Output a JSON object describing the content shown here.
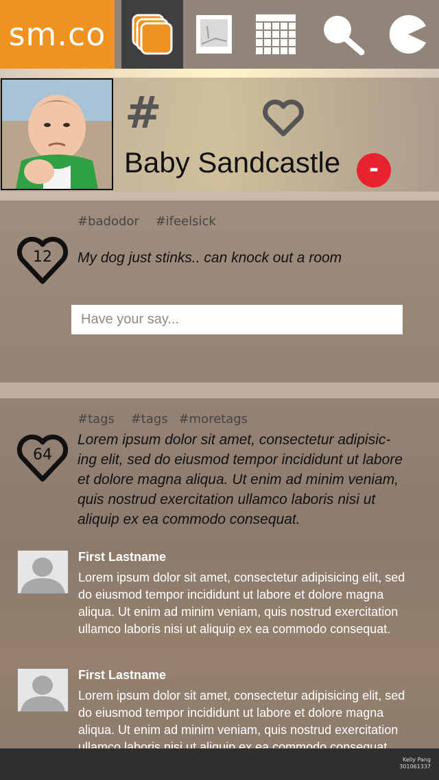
{
  "header": {
    "logo": "sm.co",
    "nav": [
      {
        "icon": "stack-cards-icon",
        "active": true
      },
      {
        "icon": "image-icon",
        "active": false
      },
      {
        "icon": "calendar-icon",
        "active": false
      },
      {
        "icon": "search-icon",
        "active": false
      },
      {
        "icon": "pacman-icon",
        "active": false
      }
    ],
    "colors": {
      "logo_bg": "#f0921f",
      "active_nav": "#3f3f3f",
      "remove": "#e8232f"
    }
  },
  "profile": {
    "name": "Baby Sandcastle",
    "hash_symbol": "#",
    "remove_label": "-"
  },
  "posts": [
    {
      "tags": [
        "#badodor",
        "#ifeelsick"
      ],
      "likes": "12",
      "text": "My dog just stinks.. can knock out a room",
      "comment_placeholder": "Have your say..."
    },
    {
      "tags": [
        "#tags",
        "#tags",
        "#moretags"
      ],
      "likes": "64",
      "text": "Lorem ipsum dolor sit amet, consectetur adipisic-ing elit, sed do eiusmod tempor incididunt ut labore et dolore magna aliqua. Ut enim ad minim veniam, quis nostrud exercitation ullamco laboris nisi ut aliquip ex ea commodo consequat.",
      "comments": [
        {
          "name": "First Lastname",
          "text": "Lorem ipsum dolor sit amet, consectetur adipisicing elit, sed do eiusmod tempor incididunt ut labore et dolore magna aliqua. Ut enim ad minim veniam, quis nostrud exercitation ullamco laboris nisi ut aliquip ex ea commodo consequat."
        },
        {
          "name": "First Lastname",
          "text": "Lorem ipsum dolor sit amet, consectetur adipisicing elit, sed do eiusmod tempor incididunt ut labore et dolore magna aliqua. Ut enim ad minim veniam, quis nostrud exercitation ullamco laboris nisi ut aliquip ex ea commodo consequat."
        }
      ]
    }
  ],
  "footer": {
    "author_name": "Kelly Pang",
    "author_id": "301061337"
  }
}
